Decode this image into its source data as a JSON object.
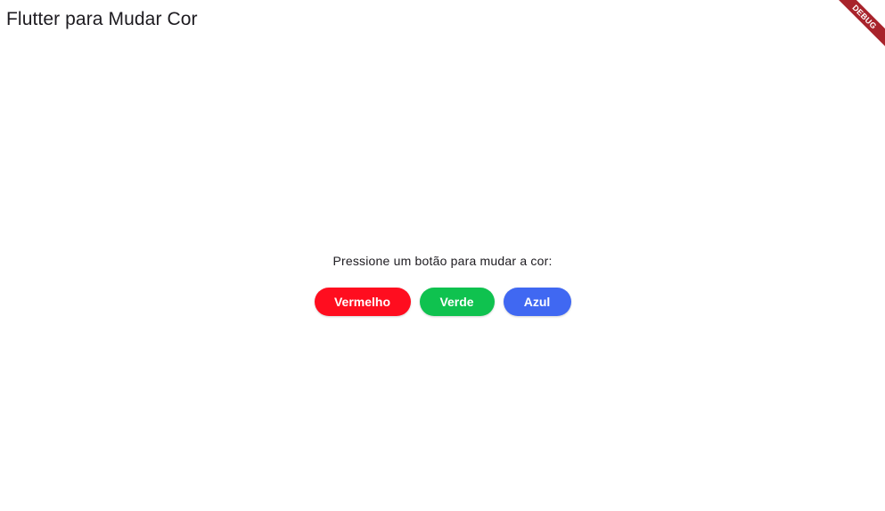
{
  "app_bar": {
    "title": "Flutter para Mudar Cor"
  },
  "main": {
    "prompt": "Pressione um botão para mudar a cor:",
    "buttons": [
      {
        "label": "Vermelho",
        "color": "#ff0d1f"
      },
      {
        "label": "Verde",
        "color": "#0fc24f"
      },
      {
        "label": "Azul",
        "color": "#4068f2"
      }
    ]
  },
  "debug_banner": {
    "label": "DEBUG",
    "color": "#a8232b"
  }
}
